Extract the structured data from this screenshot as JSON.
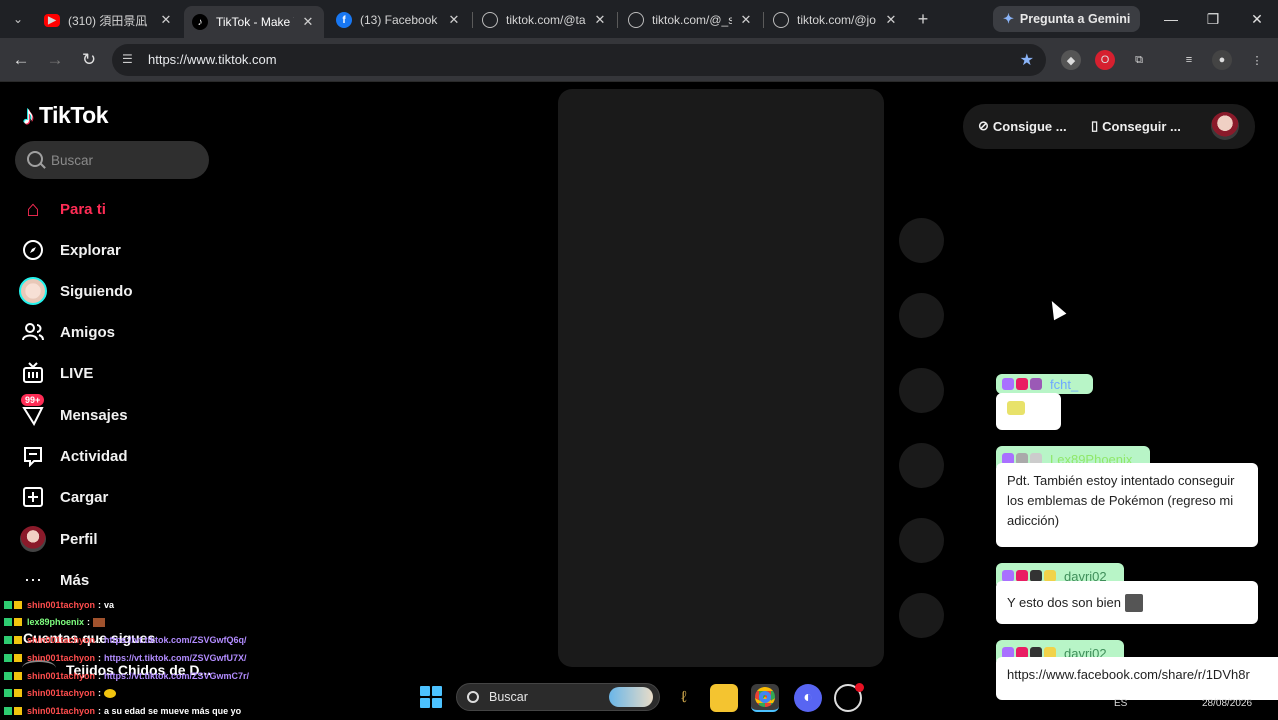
{
  "browser": {
    "tabs": [
      {
        "title": "(310) 須田景凪",
        "icon": "youtube-icon",
        "color": "#ff0000"
      },
      {
        "title": "TikTok - Make Y",
        "icon": "tiktok-icon",
        "color": "#000000"
      },
      {
        "title": "(13) Facebook",
        "icon": "facebook-icon",
        "color": "#1877f2"
      },
      {
        "title": "tiktok.com/@ta",
        "icon": "globe-icon",
        "color": "#9aa0a6"
      },
      {
        "title": "tiktok.com/@_s",
        "icon": "globe-icon",
        "color": "#9aa0a6"
      },
      {
        "title": "tiktok.com/@jo",
        "icon": "globe-icon",
        "color": "#9aa0a6"
      }
    ],
    "gemini_label": "Pregunta a Gemini",
    "url": "https://www.tiktok.com"
  },
  "tiktok": {
    "logo": "TikTok",
    "search_placeholder": "Buscar",
    "nav": [
      {
        "label": "Para ti",
        "icon": "home-icon"
      },
      {
        "label": "Explorar",
        "icon": "compass-icon"
      },
      {
        "label": "Siguiendo",
        "icon": "following-avatar-icon"
      },
      {
        "label": "Amigos",
        "icon": "friends-icon"
      },
      {
        "label": "LIVE",
        "icon": "live-tv-icon"
      },
      {
        "label": "Mensajes",
        "icon": "messages-icon",
        "badge": "99+"
      },
      {
        "label": "Actividad",
        "icon": "activity-icon"
      },
      {
        "label": "Cargar",
        "icon": "upload-icon"
      },
      {
        "label": "Perfil",
        "icon": "profile-avatar-icon"
      },
      {
        "label": "Más",
        "icon": "more-icon"
      }
    ],
    "following_heading": "Cuentas que sigues",
    "following_first": "Tejidos Chidos de D...",
    "topright": {
      "coins_label": "Consigue ...",
      "app_label": "Conseguir ..."
    },
    "accent": "#fe2c55"
  },
  "stream_chat": {
    "messages": [
      {
        "user": "fcht_",
        "text": ""
      },
      {
        "user": "Lex89Phoenix",
        "text": "Pdt. También estoy intentado conseguir los emblemas de Pokémon (regreso mi adicción)"
      },
      {
        "user": "davri02",
        "text": "Y esto dos son bien"
      },
      {
        "user": "davri02",
        "text": "https://www.facebook.com/share/r/1DVh8r"
      }
    ],
    "small_chat": [
      {
        "user": "shin001tachyon",
        "text": "va",
        "link": ""
      },
      {
        "user": "lex89phoenix",
        "text": "",
        "link": ""
      },
      {
        "user": "shin001tachyon",
        "text": "",
        "link": "https://vt.tiktok.com/ZSVGwfQ6q/"
      },
      {
        "user": "shin001tachyon",
        "text": "",
        "link": "https://vt.tiktok.com/ZSVGwfU7X/"
      },
      {
        "user": "shin001tachyon",
        "text": "",
        "link": "https://vt.tiktok.com/ZSVGwmC7r/"
      },
      {
        "user": "shin001tachyon",
        "text": "",
        "link": ""
      },
      {
        "user": "shin001tachyon",
        "text": "a su edad se mueve más que yo",
        "link": ""
      }
    ]
  },
  "taskbar": {
    "search_label": "Buscar",
    "lang": "ES",
    "date": "28/08/2026"
  }
}
